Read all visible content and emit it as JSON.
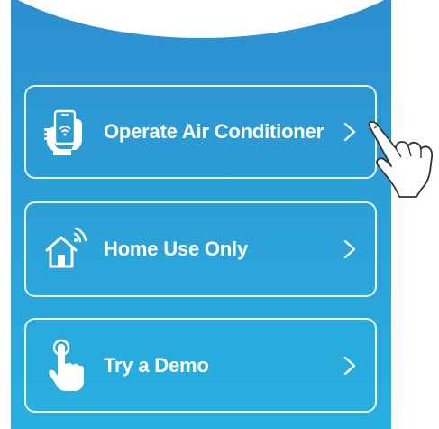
{
  "menu": {
    "items": [
      {
        "label": "Operate Air Conditioner",
        "icon": "phone-hand-icon"
      },
      {
        "label": "Home Use Only",
        "icon": "home-wifi-icon"
      },
      {
        "label": "Try a Demo",
        "icon": "tap-finger-icon"
      }
    ]
  },
  "colors": {
    "panel_top": "#2c8fd0",
    "panel_bottom": "#27b0e0",
    "card_border": "#ffffff",
    "text": "#ffffff"
  },
  "annotation": {
    "icon": "pointing-hand-icon"
  }
}
